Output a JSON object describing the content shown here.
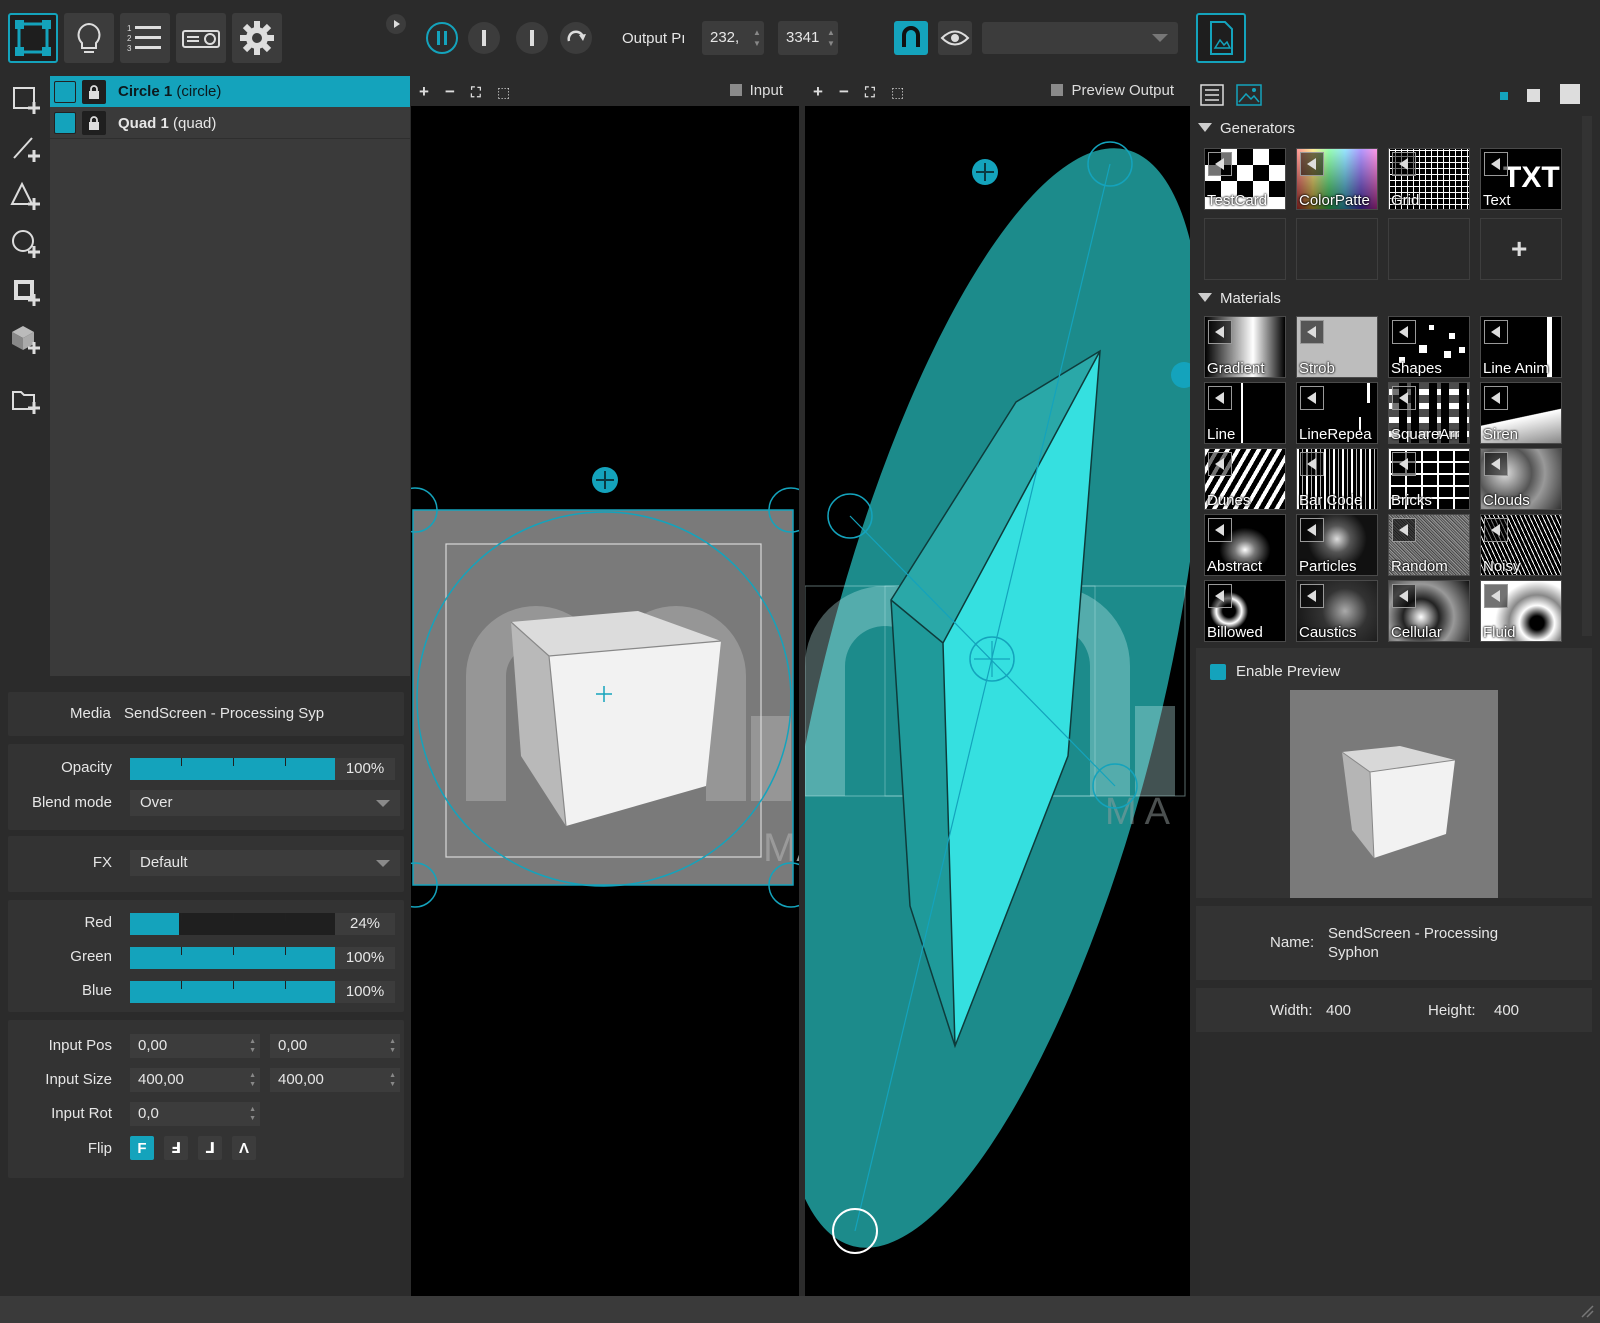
{
  "toolbar": {
    "output_label": "Output Pı",
    "output_x": "232,",
    "output_y": "3341"
  },
  "layers": [
    {
      "name": "Circle 1",
      "type": "(circle)"
    },
    {
      "name": "Quad 1",
      "type": "(quad)"
    }
  ],
  "properties": {
    "media_label": "Media",
    "media_value": "SendScreen - Processing Syp",
    "opacity_label": "Opacity",
    "opacity_value": "100%",
    "opacity_level": 1.0,
    "blend_label": "Blend mode",
    "blend_value": "Over",
    "fx_label": "FX",
    "fx_value": "Default",
    "red_label": "Red",
    "red_value": "24%",
    "red_level": 0.24,
    "green_label": "Green",
    "green_value": "100%",
    "green_level": 1.0,
    "blue_label": "Blue",
    "blue_value": "100%",
    "blue_level": 1.0,
    "input_pos_label": "Input Pos",
    "input_pos_x": "0,00",
    "input_pos_y": "0,00",
    "input_size_label": "Input Size",
    "input_size_w": "400,00",
    "input_size_h": "400,00",
    "input_rot_label": "Input Rot",
    "input_rot_value": "0,0",
    "flip_label": "Flip",
    "flip_options": [
      "F",
      "Ⅎ",
      "⅃",
      "Ʌ"
    ]
  },
  "viewports": {
    "input_title": "Input",
    "output_title": "Preview Output",
    "watermark": "MA"
  },
  "library": {
    "generators_title": "Generators",
    "generators": [
      "TestCard",
      "ColorPatte",
      "Grid",
      "Text"
    ],
    "text_tile_glyph": "TXT",
    "add_glyph": "+",
    "materials_title": "Materials",
    "materials": [
      "Gradient",
      "Strob",
      "Shapes",
      "Line Anim",
      "Line",
      "LineRepea",
      "SquareArr",
      "Siren",
      "Dunes",
      "Bar Code",
      "Bricks",
      "Clouds",
      "Abstract",
      "Particles",
      "Random",
      "Noisy",
      "Billowed",
      "Caustics",
      "Cellular",
      "Fluid"
    ]
  },
  "preview": {
    "enable_label": "Enable Preview",
    "name_label": "Name:",
    "name_value": "SendScreen - Processing Syphon",
    "width_label": "Width:",
    "width_value": "400",
    "height_label": "Height:",
    "height_value": "400"
  },
  "colors": {
    "accent": "#14a3bc",
    "panel": "#3a3a3a",
    "shape_fill": "#1e8d8d"
  }
}
